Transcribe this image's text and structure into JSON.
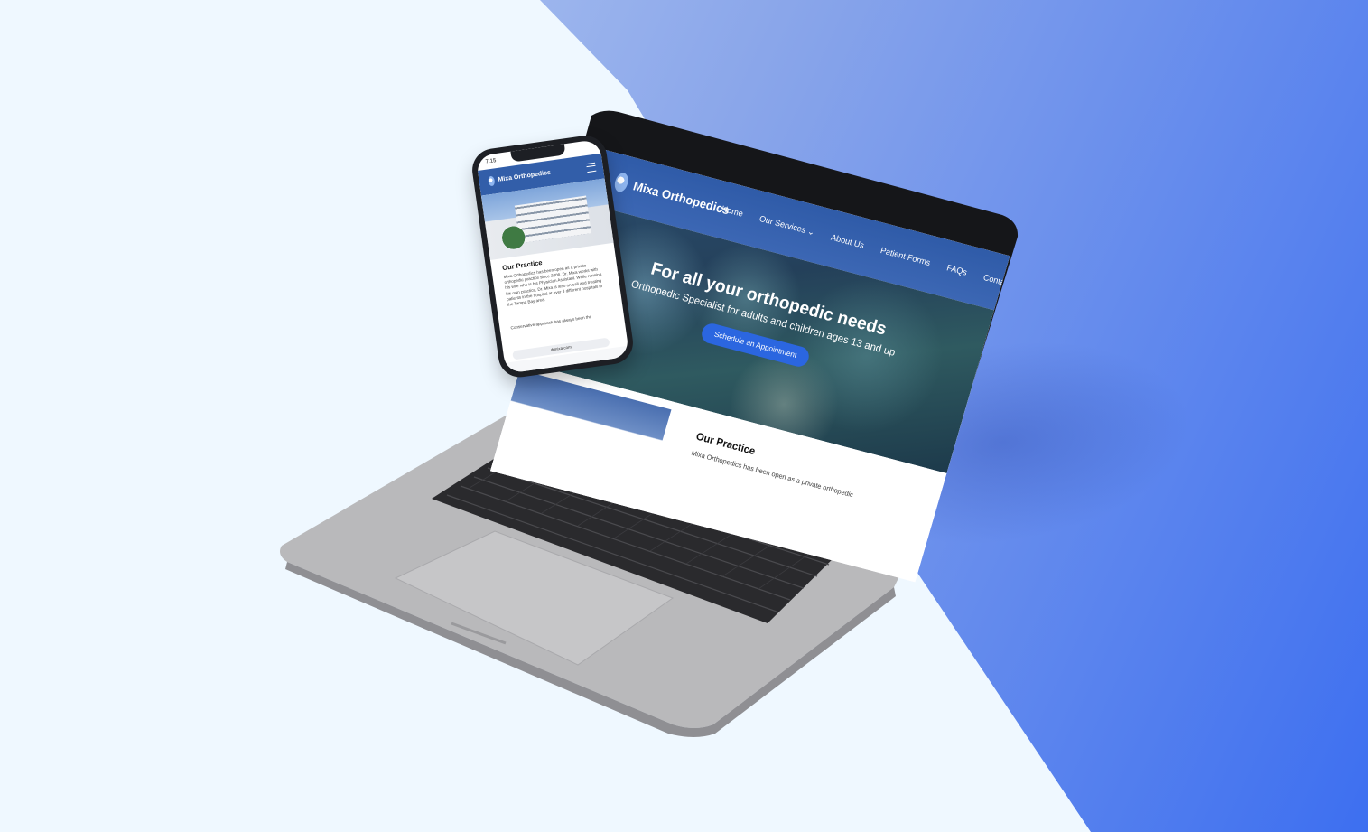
{
  "site": {
    "brand": "Mixa Orthopedics",
    "nav": [
      "Home",
      "Our Services",
      "About Us",
      "Patient Forms",
      "FAQs",
      "Contact"
    ],
    "hero_title": "For all your orthopedic needs",
    "hero_subtitle": "Orthopedic Specialist for adults and children ages 13 and up",
    "cta": "Schedule an Appointment",
    "practice_title": "Our Practice",
    "practice_text": "Mixa Orthopedics has been open as a private orthopedic"
  },
  "phone": {
    "status_time": "7:15",
    "brand": "Mixa Orthopedics",
    "section_title": "Our Practice",
    "paragraph1": "Mixa Orthopedics has been open as a private orthopedic practice since 2008. Dr. Mixa works with his wife who is his Physician Assistant. While running his own practice, Dr. Mixa is also on call and treating patients in the hospital at over 4 different hospitals in the Tampa Bay area.",
    "paragraph2": "Conservative approach has always been the",
    "url": "drmixa.com"
  },
  "colors": {
    "background": "#eff8ff",
    "gradient_end": "#3d6ff0",
    "nav_blue": "#2f5ba8",
    "cta_blue": "#2b66e0"
  }
}
